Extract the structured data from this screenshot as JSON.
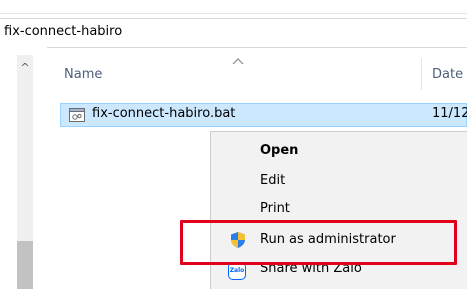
{
  "address_bar": {
    "path": "fix-connect-habiro"
  },
  "columns": {
    "name": "Name",
    "date": "Date"
  },
  "file": {
    "name": "fix-connect-habiro.bat",
    "date": "11/12"
  },
  "context_menu": {
    "items": [
      {
        "label": "Open",
        "default": true
      },
      {
        "label": "Edit"
      },
      {
        "label": "Print"
      },
      {
        "label": "Run as administrator",
        "icon": "uac-shield-icon"
      },
      {
        "label": "Share with Zalo",
        "icon": "zalo-icon",
        "icon_text": "Zalo"
      }
    ]
  },
  "colors": {
    "selection_bg": "#cce8ff",
    "selection_border": "#99d1ff",
    "highlight_box": "#e0001b",
    "menu_bg": "#f2f2f2",
    "header_text": "#4c607a"
  }
}
